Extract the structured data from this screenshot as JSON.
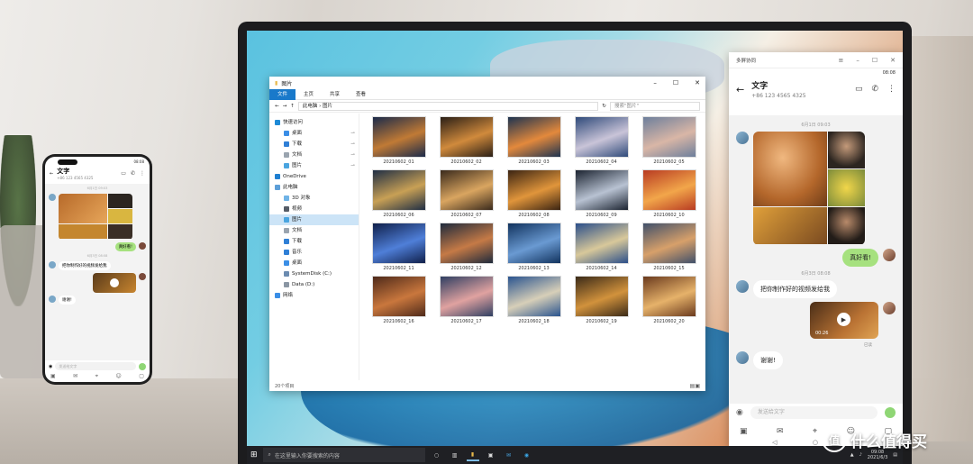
{
  "phone": {
    "time": "08:08",
    "contact_name": "文字",
    "contact_number": "+86 123 4565 4325",
    "timestamp_1": "6月1日 09:03",
    "reply_1": "真好看!",
    "timestamp_2": "6月3日 08:08",
    "message_1": "把你制作好的视频发给我",
    "message_2": "谢谢!",
    "input_placeholder": "发送给文字"
  },
  "explorer": {
    "title": "图片",
    "tabs": [
      "文件",
      "主页",
      "共享",
      "查看"
    ],
    "path_root": "此电脑",
    "path_leaf": "图片",
    "search_placeholder": "搜索\"图片\"",
    "sidebar": [
      {
        "label": "快速访问",
        "icon": "star-icon",
        "color": "#1e8ad6",
        "indent": 0,
        "pin": false
      },
      {
        "label": "桌面",
        "icon": "desktop-icon",
        "color": "#3a8ee6",
        "indent": 1,
        "pin": true
      },
      {
        "label": "下载",
        "icon": "download-icon",
        "color": "#2f7fd6",
        "indent": 1,
        "pin": true
      },
      {
        "label": "文档",
        "icon": "document-icon",
        "color": "#9aa4af",
        "indent": 1,
        "pin": true
      },
      {
        "label": "图片",
        "icon": "picture-icon",
        "color": "#4aa5e0",
        "indent": 1,
        "pin": true
      },
      {
        "label": "OneDrive",
        "icon": "cloud-icon",
        "color": "#1f7fd1",
        "indent": 0,
        "pin": false
      },
      {
        "label": "此电脑",
        "icon": "computer-icon",
        "color": "#5d9fd8",
        "indent": 0,
        "pin": false
      },
      {
        "label": "3D 对象",
        "icon": "cube-icon",
        "color": "#6fb3e6",
        "indent": 1,
        "pin": false
      },
      {
        "label": "视频",
        "icon": "video-icon",
        "color": "#555c66",
        "indent": 1,
        "pin": false
      },
      {
        "label": "图片",
        "icon": "picture-icon",
        "color": "#4aa5e0",
        "indent": 1,
        "pin": false,
        "selected": true
      },
      {
        "label": "文档",
        "icon": "document-icon",
        "color": "#9aa4af",
        "indent": 1,
        "pin": false
      },
      {
        "label": "下载",
        "icon": "download-icon",
        "color": "#2f7fd6",
        "indent": 1,
        "pin": false
      },
      {
        "label": "音乐",
        "icon": "music-icon",
        "color": "#2f7fd6",
        "indent": 1,
        "pin": false
      },
      {
        "label": "桌面",
        "icon": "desktop-icon",
        "color": "#3a8ee6",
        "indent": 1,
        "pin": false
      },
      {
        "label": "SystemDisk (C:)",
        "icon": "drive-icon",
        "color": "#6b8bb0",
        "indent": 1,
        "pin": false
      },
      {
        "label": "Data (D:)",
        "icon": "drive-icon",
        "color": "#8a96a3",
        "indent": 1,
        "pin": false
      },
      {
        "label": "网络",
        "icon": "network-icon",
        "color": "#3a8ee6",
        "indent": 0,
        "pin": false
      }
    ],
    "files": [
      {
        "name": "20210602_01",
        "c1": "#1a2a4a",
        "c2": "#c07a35"
      },
      {
        "name": "20210602_02",
        "c1": "#2a1f16",
        "c2": "#d08a3c"
      },
      {
        "name": "20210602_03",
        "c1": "#1d3350",
        "c2": "#e3893c"
      },
      {
        "name": "20210602_04",
        "c1": "#2f4a7a",
        "c2": "#c9c4d8"
      },
      {
        "name": "20210602_05",
        "c1": "#6d7f9c",
        "c2": "#d9b6a6"
      },
      {
        "name": "20210602_06",
        "c1": "#1f2e44",
        "c2": "#c8a055"
      },
      {
        "name": "20210602_07",
        "c1": "#3a2a1c",
        "c2": "#d9a560"
      },
      {
        "name": "20210602_08",
        "c1": "#3b2412",
        "c2": "#e0953b"
      },
      {
        "name": "20210602_09",
        "c1": "#1b2330",
        "c2": "#b8c2d2"
      },
      {
        "name": "20210602_10",
        "c1": "#b83b22",
        "c2": "#f2a64a"
      },
      {
        "name": "20210602_11",
        "c1": "#10204a",
        "c2": "#4f7fd8"
      },
      {
        "name": "20210602_12",
        "c1": "#1e2a3c",
        "c2": "#c57a46"
      },
      {
        "name": "20210602_13",
        "c1": "#12335e",
        "c2": "#6a9ad2"
      },
      {
        "name": "20210602_14",
        "c1": "#2b4f8a",
        "c2": "#d8c89a"
      },
      {
        "name": "20210602_15",
        "c1": "#40506a",
        "c2": "#d7a06a"
      },
      {
        "name": "20210602_16",
        "c1": "#4e2a1a",
        "c2": "#c9773d"
      },
      {
        "name": "20210602_17",
        "c1": "#2f3f62",
        "c2": "#e0a2a0"
      },
      {
        "name": "20210602_18",
        "c1": "#2a548f",
        "c2": "#d7cfb8"
      },
      {
        "name": "20210602_19",
        "c1": "#3a2a18",
        "c2": "#d1923c"
      },
      {
        "name": "20210602_20",
        "c1": "#6a3a1e",
        "c2": "#e6b26a"
      }
    ],
    "item_count": "20个项目"
  },
  "chat": {
    "window_title": "多屏协同",
    "time": "08:08",
    "contact_name": "文字",
    "contact_number": "+86 123 4565 4325",
    "timestamp_1": "6月1日 09:03",
    "reply_1": "真好看!",
    "timestamp_2": "6月3日 08:08",
    "message_1": "把你制作好的视频发给我",
    "video_duration": "00:26",
    "read_status": "已读",
    "message_2": "谢谢!",
    "input_placeholder": "发送给文字"
  },
  "taskbar": {
    "search_placeholder": "在这里输入你要搜索的内容",
    "clock_time": "09:08",
    "clock_date": "2021/6/3"
  },
  "watermark": {
    "logo": "值",
    "text": "什么值得买"
  },
  "colors": {
    "accent_blue": "#1979ca",
    "bubble_green": "#a6e17f"
  }
}
